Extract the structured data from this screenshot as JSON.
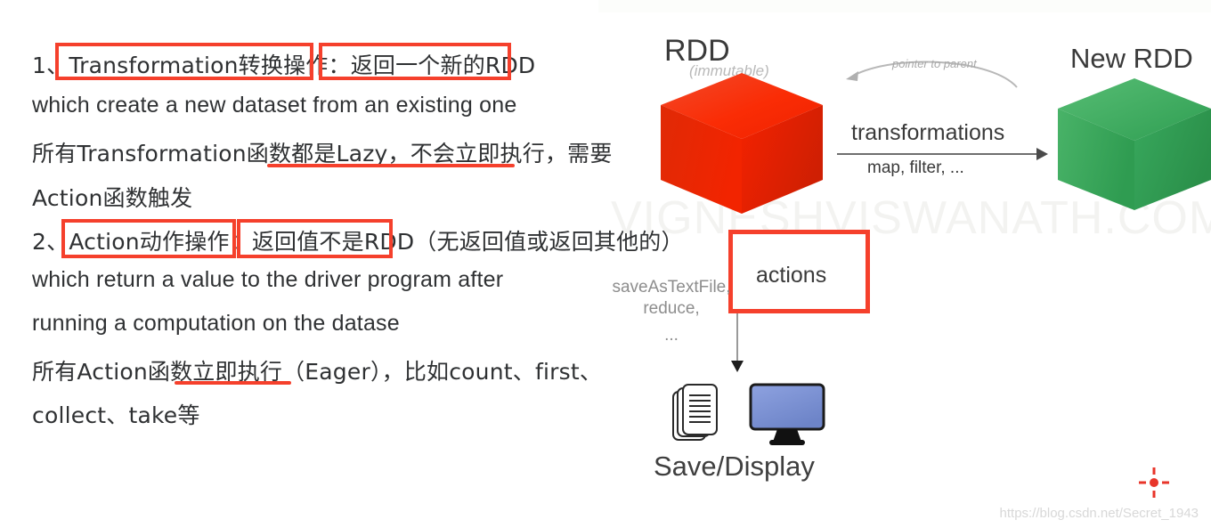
{
  "notes": {
    "item1": {
      "number": "1、",
      "boxed_term": "Transformation转换操作",
      "colon": "：",
      "boxed_result": "返回一个新的RDD",
      "english": "which create a new dataset from an existing one",
      "detail_line1": "所有Transformation函数都是Lazy，不会立即执行，需要",
      "detail_line2": "Action函数触发"
    },
    "item2": {
      "number": "2、",
      "boxed_term": "Action动作操作：",
      "boxed_result": "返回值不是RDD",
      "tail": "（无返回值或返回其他的）",
      "english_line1": "which return a value to the driver program after",
      "english_line2": "running a computation on the datase",
      "detail_line1": "所有Action函数立即执行（Eager），比如count、first、",
      "detail_line2": "collect、take等"
    }
  },
  "diagram": {
    "rdd_title": "RDD",
    "rdd_subtitle": "(immutable)",
    "new_rdd_title": "New RDD",
    "pointer_label": "pointer to parent",
    "transformations_label": "transformations",
    "transformations_examples": "map, filter, ...",
    "actions_label": "actions",
    "action_examples_line1": "saveAsTextFile,",
    "action_examples_line2": "reduce,",
    "action_examples_line3": "...",
    "save_display_label": "Save/Display",
    "watermark": "VIGNESHVISWANATH.COM"
  },
  "footer": {
    "blog_url": "https://blog.csdn.net/Secret_1943"
  },
  "colors": {
    "highlight_red": "#f5402c",
    "rdd_cube": "#ef2200",
    "new_rdd_cube": "#35a85b",
    "monitor_blue": "#7e93d8",
    "text": "#2f3133"
  }
}
